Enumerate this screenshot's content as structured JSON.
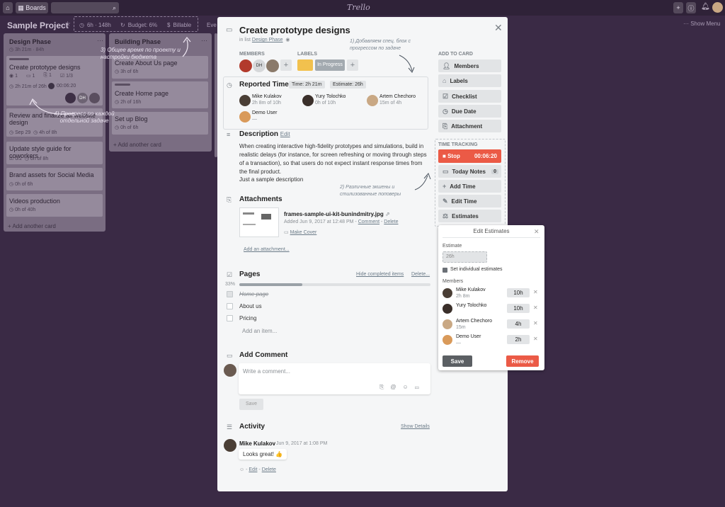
{
  "topbar": {
    "boards_label": "Boards",
    "logo": "Trello",
    "show_menu": "Show Menu"
  },
  "board": {
    "title": "Sample Project",
    "time_total": "6h · 148h",
    "budget": "Budget: 6%",
    "billable": "Billable",
    "partial_tab": "Eve"
  },
  "lists": [
    {
      "title": "Design Phase",
      "meta": "3h 21m · 84h",
      "cards": [
        {
          "title": "Create prototype designs",
          "meta1": "1",
          "meta2": "1",
          "meta3": "1",
          "meta4": "1/3",
          "time": "2h 21m of 26h",
          "timer": "00:06:20"
        },
        {
          "title": "Review and finalize all website design",
          "meta": "Sep 29",
          "time": "4h of 8h"
        },
        {
          "title": "Update style guide for coworkers",
          "meta": "0/2",
          "time": "0h of 8h"
        },
        {
          "title": "Brand assets for Social Media",
          "time": "0h of 6h"
        },
        {
          "title": "Videos production",
          "time": "0h of 40h"
        }
      ],
      "add_card": "+ Add another card"
    },
    {
      "title": "Building Phase",
      "cards": [
        {
          "title": "Create About Us page",
          "time": "3h of 6h"
        },
        {
          "title": "Create Home page",
          "time": "2h of 16h"
        },
        {
          "title": "Set up Blog",
          "time": "0h of 6h"
        }
      ],
      "add_card": "+ Add another card"
    }
  ],
  "annotations": {
    "a1": "1) Добавляем спец. блок с прогрессом по задаче",
    "a2": "2) Различные экшены и стилизованные поповеры",
    "a3": "3) Общее время по проекту и настройки бюджета",
    "a4": "4) Прогресс по каждой отдельной задаче"
  },
  "modal": {
    "title": "Create prototype designs",
    "in_list_prefix": "in list",
    "in_list": "Design Phase",
    "members_label": "MEMBERS",
    "labels_label": "LABELS",
    "label_in_progress": "In Progress",
    "member_initials": "DH",
    "reported": {
      "title": "Reported Time",
      "time": "Time: 2h 21m",
      "estimate": "Estimate: 26h",
      "people": [
        {
          "name": "Mike Kulakov",
          "value": "2h 8m of 10h"
        },
        {
          "name": "Yury Tolochko",
          "value": "0h of 10h"
        },
        {
          "name": "Artem Chechoro",
          "value": "15m of 4h"
        },
        {
          "name": "Demo User",
          "value": "—"
        }
      ]
    },
    "description": {
      "title": "Description",
      "edit": "Edit",
      "body": "When creating interactive high-fidelity prototypes and simulations, build in realistic delays (for instance, for screen refreshing or moving through steps of a transaction), so that users do not expect instant response times from the final product.",
      "sample": "Just a sample description"
    },
    "attachments": {
      "title": "Attachments",
      "filename": "frames-sample-ui-kit-bunindmitry.jpg",
      "added": "Added Jun 9, 2017 at 12:48 PM",
      "comment": "Comment",
      "delete": "Delete",
      "make_cover": "Make Cover",
      "add": "Add an attachment..."
    },
    "pages": {
      "title": "Pages",
      "hide": "Hide completed items",
      "delete": "Delete...",
      "percent": "33%",
      "progress": 0.33,
      "items": [
        "Home page",
        "About us",
        "Pricing"
      ],
      "add": "Add an item..."
    },
    "comment": {
      "title": "Add Comment",
      "placeholder": "Write a comment...",
      "save": "Save"
    },
    "activity": {
      "title": "Activity",
      "show": "Show Details",
      "user": "Mike Kulakov",
      "date": "Jun 9, 2017 at 1:08 PM",
      "text": "Looks great! 👍",
      "edit": "Edit",
      "delete": "Delete"
    }
  },
  "sidebar": {
    "add_to_card": "ADD TO CARD",
    "buttons": [
      "Members",
      "Labels",
      "Checklist",
      "Due Date",
      "Attachment"
    ],
    "time_tracking": "TIME TRACKING",
    "stop": "Stop",
    "timer": "00:06:20",
    "today_notes": "Today Notes",
    "today_count": "0",
    "add_time": "Add Time",
    "edit_time": "Edit Time",
    "estimates": "Estimates"
  },
  "estimates": {
    "title": "Edit Estimates",
    "estimate_label": "Estimate",
    "estimate_value": "26h",
    "individual": "Set individual estimates",
    "members_label": "Members",
    "members": [
      {
        "name": "Mike Kulakov",
        "sub": "2h 8m",
        "value": "10h"
      },
      {
        "name": "Yury Tolochko",
        "sub": "",
        "value": "10h"
      },
      {
        "name": "Artem Chechoro",
        "sub": "15m",
        "value": "4h"
      },
      {
        "name": "Demo User",
        "sub": "—",
        "value": "2h"
      }
    ],
    "save": "Save",
    "remove": "Remove"
  },
  "colors": {
    "background": "#3a2a45",
    "label_yellow": "#f2c14e",
    "label_in_progress": "#a3aab0",
    "stop_red": "#eb5a46"
  }
}
